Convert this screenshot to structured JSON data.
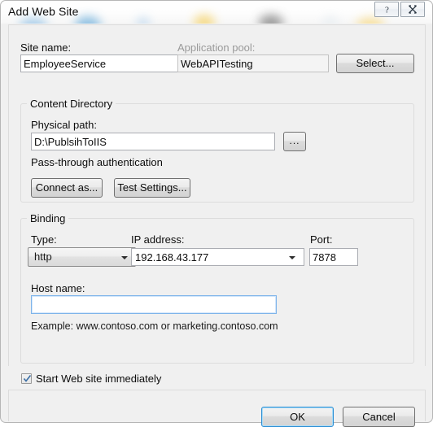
{
  "window": {
    "title": "Add Web Site",
    "help_icon": "question-mark-icon",
    "close_icon": "close-icon"
  },
  "site": {
    "name_label": "Site name:",
    "name_value": "EmployeeService",
    "apppool_label": "Application pool:",
    "apppool_value": "WebAPITesting",
    "select_button": "Select..."
  },
  "content_directory": {
    "group_title": "Content Directory",
    "physical_path_label": "Physical path:",
    "physical_path_value": "D:\\PublsihToIIS",
    "browse_button": "...",
    "passthrough_label": "Pass-through authentication",
    "connect_as_button": "Connect as...",
    "test_settings_button": "Test Settings..."
  },
  "binding": {
    "group_title": "Binding",
    "type_label": "Type:",
    "type_value": "http",
    "ip_label": "IP address:",
    "ip_value": "192.168.43.177",
    "port_label": "Port:",
    "port_value": "7878",
    "host_label": "Host name:",
    "host_value": "",
    "host_placeholder": "",
    "example_text": "Example: www.contoso.com or marketing.contoso.com"
  },
  "footer": {
    "start_checkbox_label": "Start Web site immediately",
    "start_checkbox_checked": true,
    "ok_button": "OK",
    "cancel_button": "Cancel"
  },
  "colors": {
    "dialog_bg": "#f0f0f0",
    "focus_blue": "#2a8dd4",
    "group_border": "#dcdcdc",
    "disabled_text": "#9a9a9a"
  }
}
